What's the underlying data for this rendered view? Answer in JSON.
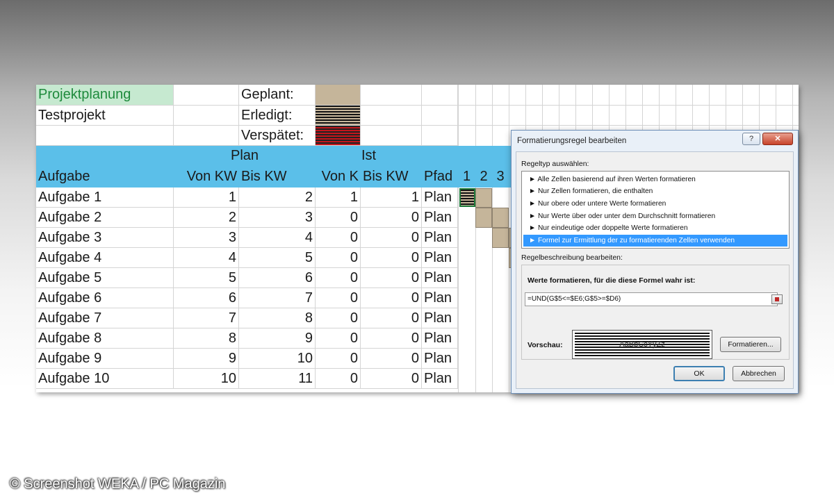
{
  "sheet": {
    "info": {
      "title": "Projektplanung",
      "project": "Testprojekt",
      "legend": [
        {
          "label": "Geplant:",
          "style": "tan"
        },
        {
          "label": "Erledigt:",
          "style": "stripes-dark"
        },
        {
          "label": "Verspätet:",
          "style": "stripes-red"
        }
      ]
    },
    "header": {
      "plan": "Plan",
      "ist": "Ist",
      "aufgabe": "Aufgabe",
      "von_kw": "Von KW",
      "bis_kw": "Bis KW",
      "von_k": "Von K",
      "bis_kw2": "Bis KW",
      "pfad": "Pfad",
      "weeks": [
        "1",
        "2",
        "3"
      ]
    },
    "rows": [
      {
        "task": "Aufgabe 1",
        "plan_von": "1",
        "plan_bis": "2",
        "ist_von": "1",
        "ist_bis": "1",
        "pfad": "Plan"
      },
      {
        "task": "Aufgabe 2",
        "plan_von": "2",
        "plan_bis": "3",
        "ist_von": "0",
        "ist_bis": "0",
        "pfad": "Plan"
      },
      {
        "task": "Aufgabe 3",
        "plan_von": "3",
        "plan_bis": "4",
        "ist_von": "0",
        "ist_bis": "0",
        "pfad": "Plan"
      },
      {
        "task": "Aufgabe 4",
        "plan_von": "4",
        "plan_bis": "5",
        "ist_von": "0",
        "ist_bis": "0",
        "pfad": "Plan"
      },
      {
        "task": "Aufgabe 5",
        "plan_von": "5",
        "plan_bis": "6",
        "ist_von": "0",
        "ist_bis": "0",
        "pfad": "Plan"
      },
      {
        "task": "Aufgabe 6",
        "plan_von": "6",
        "plan_bis": "7",
        "ist_von": "0",
        "ist_bis": "0",
        "pfad": "Plan"
      },
      {
        "task": "Aufgabe 7",
        "plan_von": "7",
        "plan_bis": "8",
        "ist_von": "0",
        "ist_bis": "0",
        "pfad": "Plan"
      },
      {
        "task": "Aufgabe 8",
        "plan_von": "8",
        "plan_bis": "9",
        "ist_von": "0",
        "ist_bis": "0",
        "pfad": "Plan"
      },
      {
        "task": "Aufgabe 9",
        "plan_von": "9",
        "plan_bis": "10",
        "ist_von": "0",
        "ist_bis": "0",
        "pfad": "Plan"
      },
      {
        "task": "Aufgabe 10",
        "plan_von": "10",
        "plan_bis": "11",
        "ist_von": "0",
        "ist_bis": "0",
        "pfad": "Plan"
      }
    ],
    "colors": {
      "header_blue": "#5bbfe9",
      "title_green_bg": "#c6e9d0",
      "title_green_text": "#1e8a3c",
      "planned_tan": "#c5b59a"
    }
  },
  "dialog": {
    "title": "Formatierungsregel bearbeiten",
    "help_label": "?",
    "close_label": "✕",
    "ruletype_label": "Regeltyp auswählen:",
    "ruletypes": [
      "Alle Zellen basierend auf ihren Werten formatieren",
      "Nur Zellen formatieren, die enthalten",
      "Nur obere oder untere Werte formatieren",
      "Nur Werte über oder unter dem Durchschnitt formatieren",
      "Nur eindeutige oder doppelte Werte formatieren",
      "Formel zur Ermittlung der zu formatierenden Zellen verwenden"
    ],
    "ruletype_arrow": "►",
    "selected_index": 5,
    "description_label": "Regelbeschreibung bearbeiten:",
    "formula_label": "Werte formatieren, für die diese Formel wahr ist:",
    "formula_value": "=UND(G$5<=$E6;G$5>=$D6)",
    "preview_label": "Vorschau:",
    "preview_text": "AaBbCcYyZz",
    "format_button": "Formatieren...",
    "ok_button": "OK",
    "cancel_button": "Abbrechen"
  },
  "credit": "© Screenshot WEKA / PC Magazin"
}
